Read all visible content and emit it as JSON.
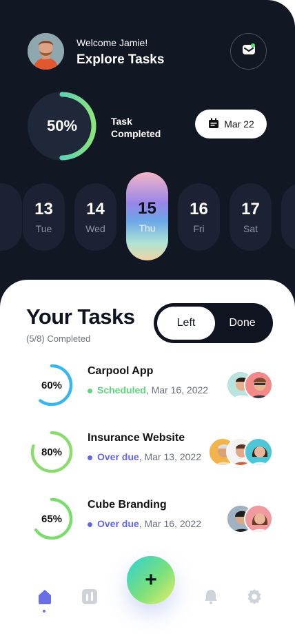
{
  "header": {
    "welcome": "Welcome Jamie!",
    "title": "Explore Tasks",
    "mail_icon": "mail-icon"
  },
  "progress": {
    "percent_label": "50%",
    "percent_value": 0.5,
    "label": "Task Completed"
  },
  "date_button": {
    "label": "Mar 22",
    "icon": "calendar-icon"
  },
  "days": [
    {
      "num": "",
      "wd": ""
    },
    {
      "num": "13",
      "wd": "Tue"
    },
    {
      "num": "14",
      "wd": "Wed"
    },
    {
      "num": "15",
      "wd": "Thu"
    },
    {
      "num": "16",
      "wd": "Fri"
    },
    {
      "num": "17",
      "wd": "Sat"
    },
    {
      "num": "",
      "wd": ""
    }
  ],
  "tasks_section": {
    "title": "Your Tasks",
    "completed": "(5/8) Completed",
    "toggle_left": "Left",
    "toggle_done": "Done"
  },
  "tasks": [
    {
      "title": "Carpool App",
      "status": "Scheduled",
      "date": ", Mar 16, 2022",
      "percent_label": "60%",
      "percent": 0.6,
      "ring_color": "#38b6ef",
      "status_color": "#5fd77c"
    },
    {
      "title": "Insurance Website",
      "status": "Over due",
      "date": ", Mar 13, 2022",
      "percent_label": "80%",
      "percent": 0.8,
      "ring_color": "#8bdc6e",
      "status_color": "#6366e8"
    },
    {
      "title": "Cube Branding",
      "status": "Over due",
      "date": ", Mar 16, 2022",
      "percent_label": "65%",
      "percent": 0.65,
      "ring_color": "#7bdc6e",
      "status_color": "#6366e8"
    }
  ],
  "nav": {
    "items": [
      "home-icon",
      "chart-icon",
      "bell-icon",
      "gear-icon"
    ],
    "fab_label": "+"
  },
  "colors": {
    "dark_bg": "#111723",
    "accent": "#6366e8",
    "ring_blue": "#38b6ef",
    "ring_green": "#8bdc6e"
  }
}
